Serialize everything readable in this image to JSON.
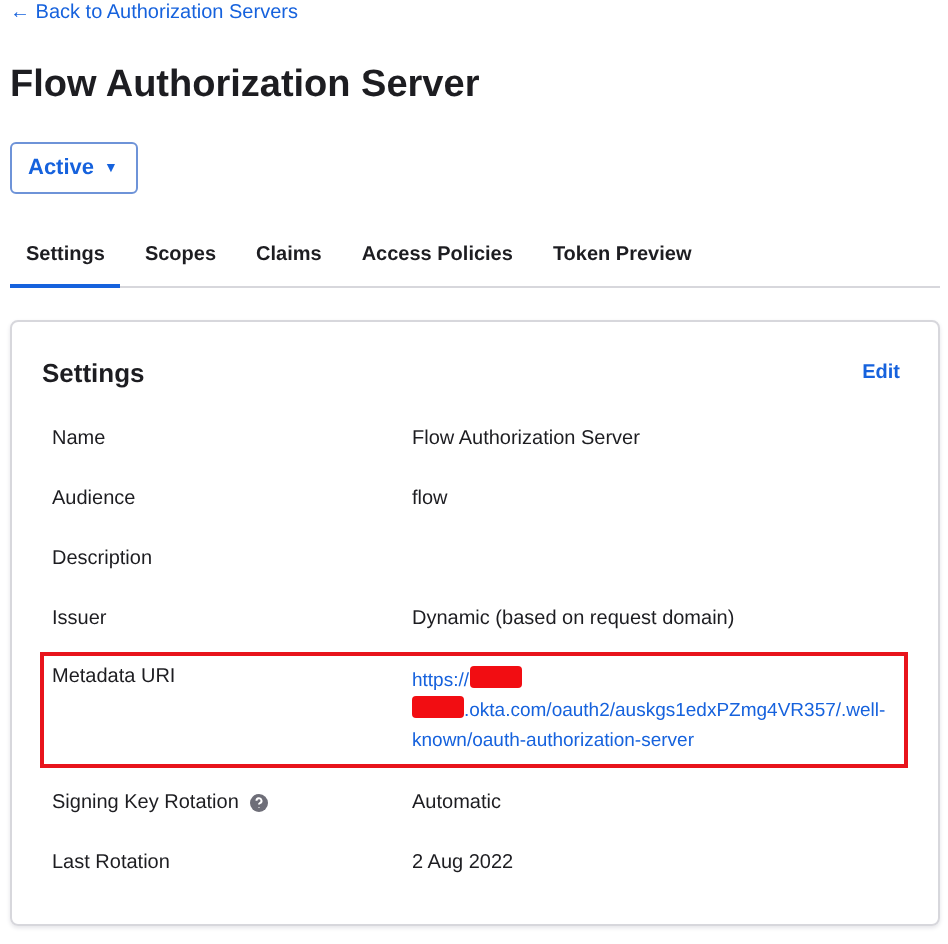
{
  "back_link": "← Back to Authorization Servers",
  "title": "Flow Authorization Server",
  "status_button": {
    "label": "Active",
    "caret": "▼"
  },
  "tabs": [
    {
      "label": "Settings",
      "selected": true
    },
    {
      "label": "Scopes",
      "selected": false
    },
    {
      "label": "Claims",
      "selected": false
    },
    {
      "label": "Access Policies",
      "selected": false
    },
    {
      "label": "Token Preview",
      "selected": false
    }
  ],
  "card": {
    "title": "Settings",
    "edit": "Edit",
    "rows": [
      {
        "label": "Name",
        "value": "Flow Authorization Server",
        "highlighted": false
      },
      {
        "label": "Audience",
        "value": "flow",
        "highlighted": false
      },
      {
        "label": "Description",
        "value": "",
        "highlighted": false
      },
      {
        "label": "Issuer",
        "value": "Dynamic (based on request domain)",
        "highlighted": false
      },
      {
        "label": "Metadata URI",
        "highlighted": true,
        "link_lines": [
          [
            {
              "kind": "text",
              "text": "https://"
            },
            {
              "kind": "redacted"
            }
          ],
          [
            {
              "kind": "redacted"
            },
            {
              "kind": "text",
              "text": ".okta.com/oauth2/auskgs1edxPZmg4VR357/.well-"
            }
          ],
          [
            {
              "kind": "text",
              "text": "known/oauth-authorization-server"
            }
          ]
        ]
      },
      {
        "label": "Signing Key Rotation",
        "help": true,
        "value": "Automatic",
        "highlighted": false
      },
      {
        "label": "Last Rotation",
        "value": "2 Aug 2022",
        "highlighted": false
      }
    ]
  }
}
